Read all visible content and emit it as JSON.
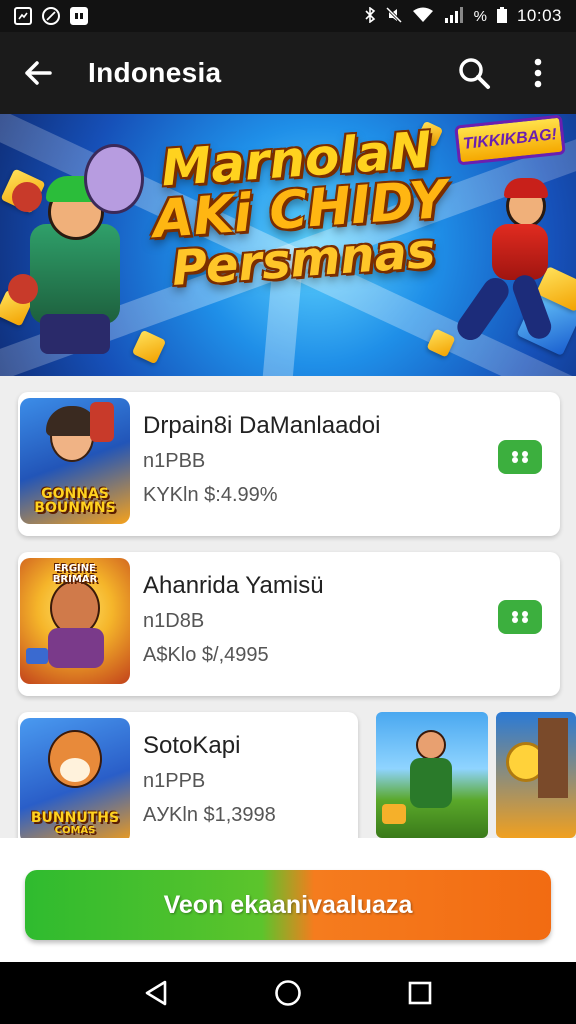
{
  "status_bar": {
    "time": "10:03",
    "battery_percent_label": "%",
    "left_icons": [
      "screenshot-icon",
      "blocked-icon",
      "mail-icon"
    ],
    "right_icons": [
      "bluetooth-icon",
      "mute-icon",
      "wifi-icon",
      "signal-icon",
      "battery-icon"
    ]
  },
  "app_bar": {
    "title": "Indonesia",
    "back_icon": "arrow-left-icon",
    "search_icon": "search-icon",
    "menu_icon": "more-vert-icon"
  },
  "banner": {
    "line1": "MarnolaN",
    "line2": "AKi CHIDY",
    "line3": "Persmnas",
    "badge": "TIKKIKBAG!"
  },
  "apps": [
    {
      "title": "Drpain8i DaManlaadoi",
      "subtitle": "n1PBB",
      "price": "KYKln $:4.99%",
      "thumb_label_line1": "GONNAS",
      "thumb_label_line2": "BOUNMNS",
      "thumb_colors": [
        "#2a6fd6",
        "#f6a21c"
      ]
    },
    {
      "title": "Ahanrida Yamisü",
      "subtitle": "n1D8B",
      "price": "A$Klo $/,4995",
      "thumb_label_line1": "ERGINE",
      "thumb_label_line2": "BRIMAR",
      "thumb_colors": [
        "#f5b52a",
        "#c2421b"
      ]
    },
    {
      "title": "SotoKapi",
      "subtitle": "n1PPB",
      "price": "AУKln $1,3998",
      "thumb_label_line1": "BUNNUTHS",
      "thumb_label_line2": "COMAS",
      "thumb_colors": [
        "#3a7ee0",
        "#f29d1a"
      ]
    }
  ],
  "cta": {
    "label": "Veon ekaanivaaluaza"
  },
  "nav": {
    "back": "nav-back-icon",
    "home": "nav-home-icon",
    "recents": "nav-recents-icon"
  }
}
